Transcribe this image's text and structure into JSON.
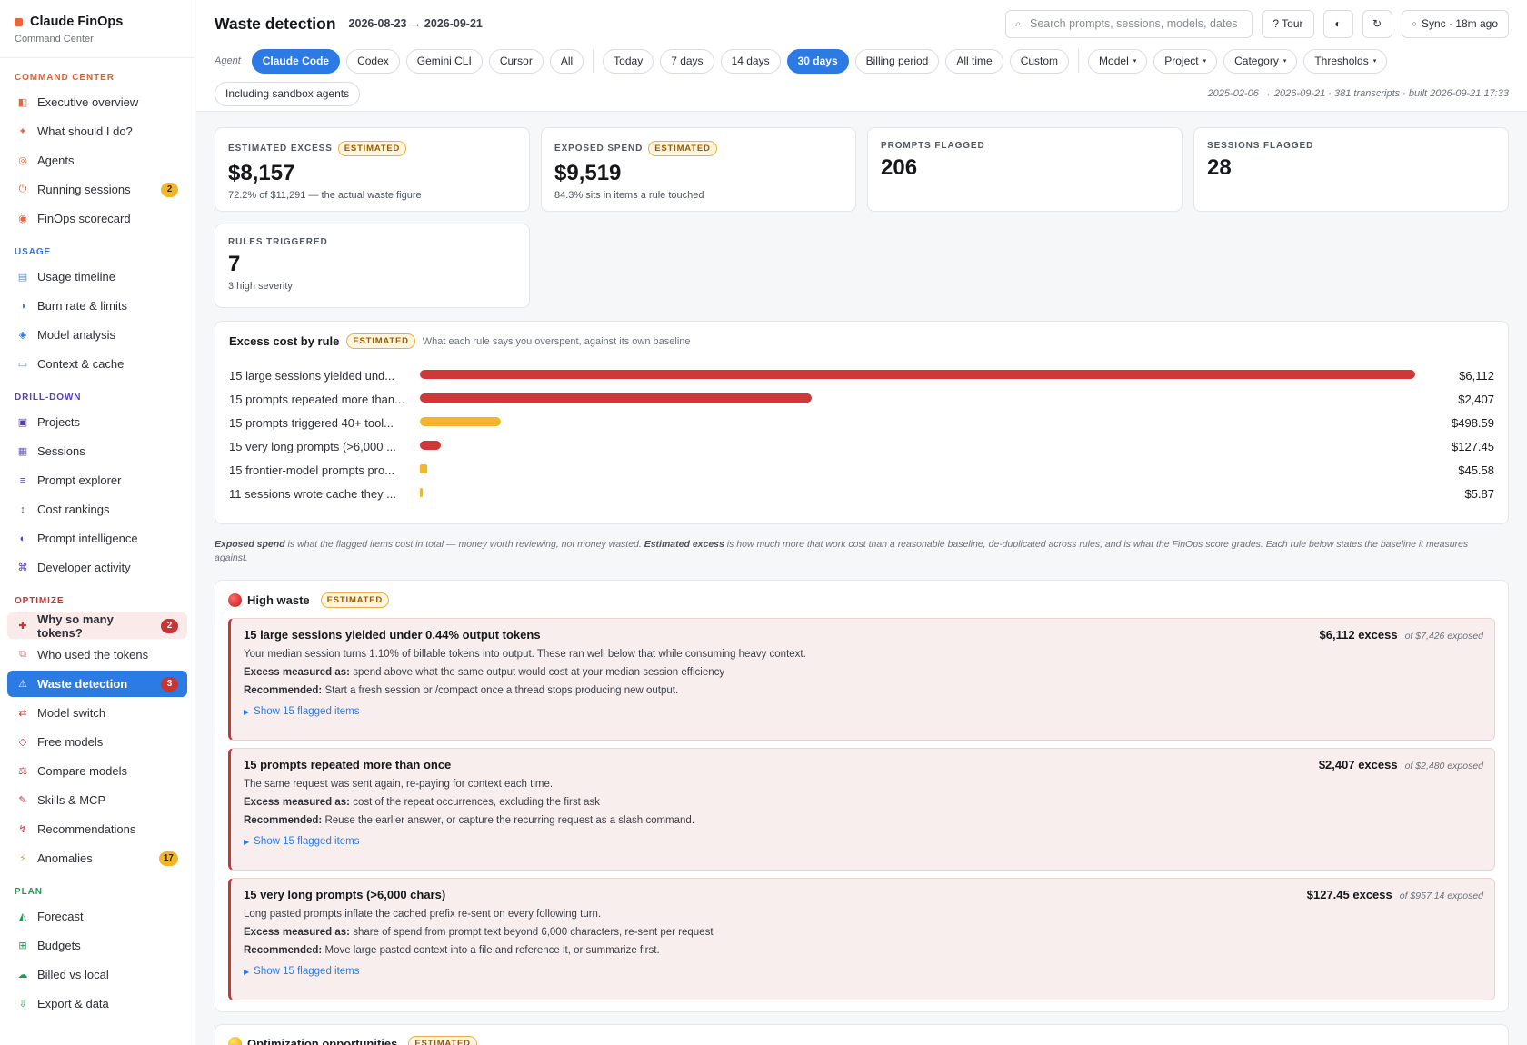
{
  "brand": {
    "title": "Claude FinOps",
    "subtitle": "Command Center"
  },
  "nav": {
    "sections": [
      {
        "title": "COMMAND CENTER",
        "color": "#e0602f",
        "items": [
          {
            "label": "Executive overview",
            "icon": "overview-icon",
            "glyph": "◧",
            "color": "#e8663d"
          },
          {
            "label": "What should I do?",
            "icon": "sparkle-icon",
            "glyph": "✦",
            "color": "#e8663d"
          },
          {
            "label": "Agents",
            "icon": "agents-icon",
            "glyph": "◎",
            "color": "#e8663d"
          },
          {
            "label": "Running sessions",
            "icon": "power-icon",
            "glyph": "⏻",
            "color": "#e8663d",
            "badge": "2",
            "badge_color": "#f5b52a"
          },
          {
            "label": "FinOps scorecard",
            "icon": "scorecard-icon",
            "glyph": "◉",
            "color": "#e8663d"
          }
        ]
      },
      {
        "title": "USAGE",
        "color": "#2c7be5",
        "items": [
          {
            "label": "Usage timeline",
            "icon": "timeline-icon",
            "glyph": "▤",
            "color": "#5b8fd9"
          },
          {
            "label": "Burn rate & limits",
            "icon": "gauge-icon",
            "glyph": "◑",
            "color": "#2c7be5"
          },
          {
            "label": "Model analysis",
            "icon": "model-icon",
            "glyph": "◈",
            "color": "#2c7be5"
          },
          {
            "label": "Context & cache",
            "icon": "cache-icon",
            "glyph": "▭",
            "color": "#5b8fd9"
          }
        ]
      },
      {
        "title": "DRILL-DOWN",
        "color": "#5b3fb5",
        "items": [
          {
            "label": "Projects",
            "icon": "projects-icon",
            "glyph": "▣",
            "color": "#5b3fb5"
          },
          {
            "label": "Sessions",
            "icon": "sessions-icon",
            "glyph": "▦",
            "color": "#6e58c0"
          },
          {
            "label": "Prompt explorer",
            "icon": "explorer-icon",
            "glyph": "≡",
            "color": "#5b3fb5"
          },
          {
            "label": "Cost rankings",
            "icon": "rankings-icon",
            "glyph": "↕",
            "color": "#5b3fb5"
          },
          {
            "label": "Prompt intelligence",
            "icon": "intelligence-icon",
            "glyph": "◐",
            "color": "#5b3fb5"
          },
          {
            "label": "Developer activity",
            "icon": "command-icon",
            "glyph": "⌘",
            "color": "#5b3fb5"
          }
        ]
      },
      {
        "title": "OPTIMIZE",
        "color": "#c93434",
        "items": [
          {
            "label": "Why so many tokens?",
            "icon": "plus-icon",
            "glyph": "✚",
            "color": "#c93434",
            "badge": "2",
            "badge_color": "#c93434",
            "state": "soft"
          },
          {
            "label": "Who used the tokens",
            "icon": "users-icon",
            "glyph": "⧉",
            "color": "#e07a7a"
          },
          {
            "label": "Waste detection",
            "icon": "warning-icon",
            "glyph": "⚠",
            "color": "#ffffff",
            "badge": "3",
            "badge_color": "#c93434",
            "state": "active"
          },
          {
            "label": "Model switch",
            "icon": "switch-icon",
            "glyph": "⇄",
            "color": "#c93434"
          },
          {
            "label": "Free models",
            "icon": "diamond-icon",
            "glyph": "◇",
            "color": "#c93434"
          },
          {
            "label": "Compare models",
            "icon": "scale-icon",
            "glyph": "⚖",
            "color": "#c93434"
          },
          {
            "label": "Skills & MCP",
            "icon": "tools-icon",
            "glyph": "✎",
            "color": "#c93434"
          },
          {
            "label": "Recommendations",
            "icon": "bolt-icon",
            "glyph": "↯",
            "color": "#c93434"
          },
          {
            "label": "Anomalies",
            "icon": "lightning-icon",
            "glyph": "⚡",
            "color": "#e8a020",
            "badge": "17",
            "badge_color": "#f5b52a"
          }
        ]
      },
      {
        "title": "PLAN",
        "color": "#1f9d55",
        "items": [
          {
            "label": "Forecast",
            "icon": "forecast-icon",
            "glyph": "◭",
            "color": "#1f9d55"
          },
          {
            "label": "Budgets",
            "icon": "budgets-icon",
            "glyph": "⊞",
            "color": "#1f9d55"
          },
          {
            "label": "Billed vs local",
            "icon": "cloud-icon",
            "glyph": "☁",
            "color": "#1f9d55"
          },
          {
            "label": "Export & data",
            "icon": "export-icon",
            "glyph": "⇩",
            "color": "#1f9d55"
          }
        ]
      }
    ]
  },
  "header": {
    "title": "Waste detection",
    "range": "2026-08-23 → 2026-09-21",
    "search_placeholder": "Search prompts, sessions, models, dates",
    "tour_label": "? Tour",
    "sync_label": "Sync · 18m ago"
  },
  "filters": {
    "agent_label": "Agent",
    "agents": [
      {
        "label": "Claude Code",
        "on": true
      },
      {
        "label": "Codex"
      },
      {
        "label": "Gemini CLI"
      },
      {
        "label": "Cursor"
      },
      {
        "label": "All"
      }
    ],
    "periods": [
      {
        "label": "Today"
      },
      {
        "label": "7 days"
      },
      {
        "label": "14 days"
      },
      {
        "label": "30 days",
        "on": true
      },
      {
        "label": "Billing period"
      },
      {
        "label": "All time"
      },
      {
        "label": "Custom"
      }
    ],
    "dropdowns": [
      "Model",
      "Project",
      "Category",
      "Thresholds"
    ],
    "sandbox_label": "Including sandbox agents",
    "meta": "2025-02-06 → 2026-09-21 · 381 transcripts · built 2026-09-21 17:33"
  },
  "kpis": [
    {
      "label": "ESTIMATED EXCESS",
      "badge": "ESTIMATED",
      "value": "$8,157",
      "sub": "72.2% of $11,291 — the actual waste figure"
    },
    {
      "label": "EXPOSED SPEND",
      "badge": "ESTIMATED",
      "value": "$9,519",
      "sub": "84.3% sits in items a rule touched"
    },
    {
      "label": "PROMPTS FLAGGED",
      "value": "206",
      "sub": ""
    },
    {
      "label": "SESSIONS FLAGGED",
      "value": "28",
      "sub": ""
    },
    {
      "label": "RULES TRIGGERED",
      "value": "7",
      "sub": "3 high severity"
    }
  ],
  "chart_data": {
    "type": "bar",
    "title": "Excess cost by rule",
    "badge": "ESTIMATED",
    "subtitle": "What each rule says you overspent, against its own baseline",
    "categories": [
      "15 large sessions yielded und...",
      "15 prompts repeated more than...",
      "15 prompts triggered 40+ tool...",
      "15 very long prompts (>6,000 ...",
      "15 frontier-model prompts pro...",
      "11 sessions wrote cache they ..."
    ],
    "values": [
      6112,
      2407,
      498.59,
      127.45,
      45.58,
      5.87
    ],
    "value_labels": [
      "$6,112",
      "$2,407",
      "$498.59",
      "$127.45",
      "$45.58",
      "$5.87"
    ],
    "bar_colors": [
      "#cf3838",
      "#cf3838",
      "#f5b52a",
      "#cf3838",
      "#f5b52a",
      "#f5b52a"
    ],
    "xlim": [
      0,
      6112
    ],
    "orientation": "horizontal"
  },
  "note": {
    "exposed_term": "Exposed spend",
    "exposed_text": " is what the flagged items cost in total — money worth reviewing, not money wasted. ",
    "excess_term": "Estimated excess",
    "excess_text": " is how much more that work cost than a reasonable baseline, de-duplicated across rules, and is what the FinOps score grades. Each rule below states the baseline it measures against."
  },
  "high_waste": {
    "title": "High waste",
    "badge": "ESTIMATED",
    "measured_label": "Excess measured as:",
    "recommended_label": "Recommended:",
    "rules": [
      {
        "title": "15 large sessions yielded under 0.44% output tokens",
        "excess": "$6,112 excess",
        "exposed": "of $7,426 exposed",
        "description": "Your median session turns 1.10% of billable tokens into output. These ran well below that while consuming heavy context.",
        "measured": "spend above what the same output would cost at your median session efficiency",
        "recommended": "Start a fresh session or /compact once a thread stops producing new output.",
        "link": "Show 15 flagged items"
      },
      {
        "title": "15 prompts repeated more than once",
        "excess": "$2,407 excess",
        "exposed": "of $2,480 exposed",
        "description": "The same request was sent again, re-paying for context each time.",
        "measured": "cost of the repeat occurrences, excluding the first ask",
        "recommended": "Reuse the earlier answer, or capture the recurring request as a slash command.",
        "link": "Show 15 flagged items"
      },
      {
        "title": "15 very long prompts (>6,000 chars)",
        "excess": "$127.45 excess",
        "exposed": "of $957.14 exposed",
        "description": "Long pasted prompts inflate the cached prefix re-sent on every following turn.",
        "measured": "share of spend from prompt text beyond 6,000 characters, re-sent per request",
        "recommended": "Move large pasted context into a file and reference it, or summarize first.",
        "link": "Show 15 flagged items"
      }
    ]
  },
  "opportunities": {
    "title": "Optimization opportunities",
    "badge": "ESTIMATED"
  }
}
